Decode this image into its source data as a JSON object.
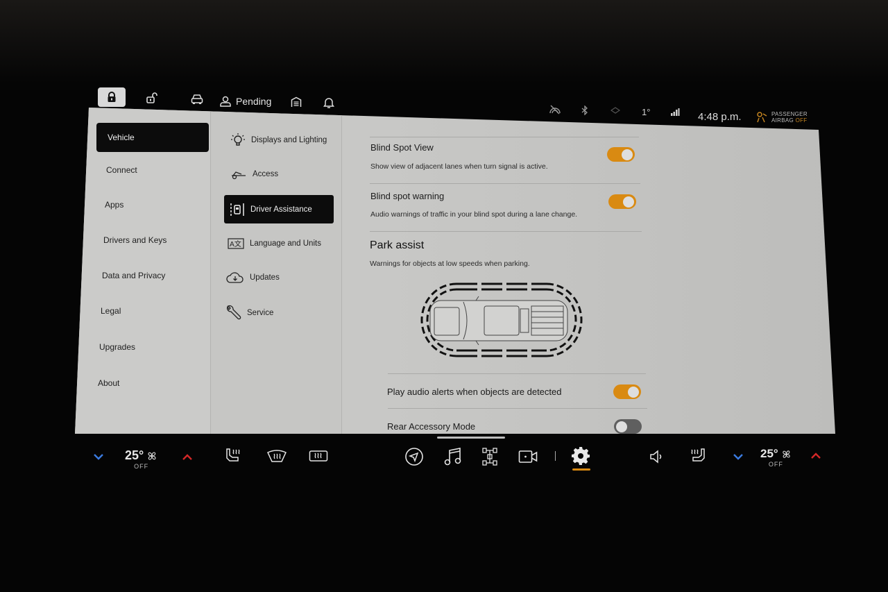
{
  "topbar": {
    "lock_icon": "lock-icon",
    "unlock_icon": "unlock-icon",
    "vehicle_icon": "car-icon",
    "profile_label": "Pending",
    "profile_icon": "user-icon",
    "garage_icon": "garage-icon",
    "notifications_icon": "bell-icon"
  },
  "status": {
    "icons": [
      "park-sense-off-icon",
      "bluetooth-icon",
      "wifi-icon",
      "signal-icon"
    ],
    "temperature_outside": "1°",
    "time": "4:48 p.m.",
    "airbag_line1": "PASSENGER",
    "airbag_line2": "AIRBAG",
    "airbag_state": "OFF"
  },
  "sidebar": {
    "items": [
      {
        "label": "Vehicle",
        "active": true
      },
      {
        "label": "Connect"
      },
      {
        "label": "Apps"
      },
      {
        "label": "Drivers and Keys"
      },
      {
        "label": "Data and Privacy"
      },
      {
        "label": "Legal"
      },
      {
        "label": "Upgrades"
      },
      {
        "label": "About"
      }
    ]
  },
  "subnav": {
    "items": [
      {
        "label": "Displays and Lighting",
        "icon": "light-bulb-icon"
      },
      {
        "label": "Access",
        "icon": "car-access-icon"
      },
      {
        "label": "Driver Assistance",
        "icon": "driver-assist-icon",
        "active": true
      },
      {
        "label": "Language and Units",
        "icon": "language-icon"
      },
      {
        "label": "Updates",
        "icon": "cloud-download-icon"
      },
      {
        "label": "Service",
        "icon": "wrench-icon"
      }
    ]
  },
  "content": {
    "blind_spot_view": {
      "title": "Blind Spot View",
      "description": "Show view of adjacent lanes when turn signal is active.",
      "enabled": true
    },
    "blind_spot_warning": {
      "title": "Blind spot warning",
      "description": "Audio warnings of traffic in your blind spot during a lane change.",
      "enabled": true
    },
    "park_assist": {
      "title": "Park assist",
      "description": "Warnings for objects at low speeds when parking."
    },
    "audio_alerts": {
      "title": "Play audio alerts when objects are detected",
      "enabled": true
    },
    "rear_accessory": {
      "title": "Rear Accessory Mode",
      "enabled": false
    }
  },
  "climate": {
    "driver_temp": "25°",
    "driver_fan": "OFF",
    "passenger_temp": "25°",
    "passenger_fan": "OFF"
  },
  "colors": {
    "accent": "#d98a12",
    "temp_down": "#3b7be0",
    "temp_up": "#d42828"
  }
}
